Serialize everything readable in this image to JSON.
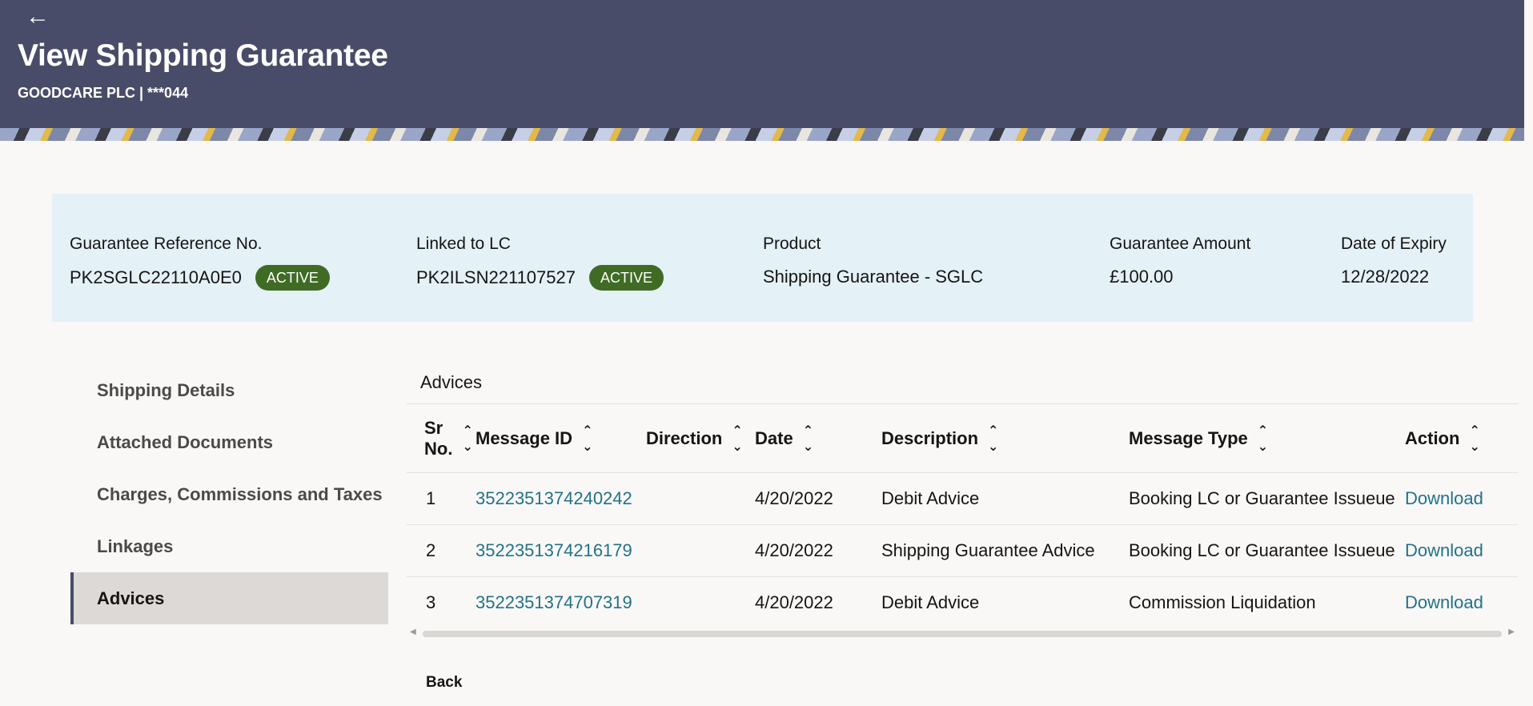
{
  "header": {
    "back_icon": "arrow-left-icon",
    "title": "View Shipping Guarantee",
    "subtitle": "GOODCARE PLC | ***044"
  },
  "summary": {
    "guarantee_ref_label": "Guarantee Reference No.",
    "guarantee_ref_value": "PK2SGLC22110A0E0",
    "guarantee_status": "ACTIVE",
    "linked_lc_label": "Linked to LC",
    "linked_lc_value": "PK2ILSN221107527",
    "linked_lc_status": "ACTIVE",
    "product_label": "Product",
    "product_value": "Shipping Guarantee - SGLC",
    "amount_label": "Guarantee Amount",
    "amount_value": "£100.00",
    "expiry_label": "Date of Expiry",
    "expiry_value": "12/28/2022"
  },
  "sidenav": {
    "items": [
      {
        "label": "Shipping Details"
      },
      {
        "label": "Attached Documents"
      },
      {
        "label": "Charges, Commissions and Taxes"
      },
      {
        "label": "Linkages"
      },
      {
        "label": "Advices"
      }
    ],
    "active": "Advices"
  },
  "advices": {
    "title": "Advices",
    "columns": {
      "sr_no_line1": "Sr",
      "sr_no_line2": "No.",
      "message_id": "Message ID",
      "direction": "Direction",
      "date": "Date",
      "description": "Description",
      "message_type": "Message Type",
      "action": "Action"
    },
    "rows": [
      {
        "sr": "1",
        "message_id": "3522351374240242",
        "direction": "",
        "date": "4/20/2022",
        "description": "Debit Advice",
        "message_type": "Booking LC or Guarantee Issue",
        "message_type_overflow": "ue",
        "action": "Download"
      },
      {
        "sr": "2",
        "message_id": "3522351374216179",
        "direction": "",
        "date": "4/20/2022",
        "description": "Shipping Guarantee Advice",
        "message_type": "Booking LC or Guarantee Issue",
        "message_type_overflow": "ue",
        "action": "Download"
      },
      {
        "sr": "3",
        "message_id": "3522351374707319",
        "direction": "",
        "date": "4/20/2022",
        "description": "Debit Advice",
        "message_type": "Commission Liquidation",
        "message_type_overflow": "",
        "action": "Download"
      }
    ]
  },
  "footer": {
    "back_label": "Back"
  },
  "colors": {
    "header_bg": "#484c68",
    "summary_bg": "#e4f1f7",
    "badge_bg": "#3f6b24",
    "link": "#227289",
    "nav_active_bg": "#dcd9d7"
  }
}
